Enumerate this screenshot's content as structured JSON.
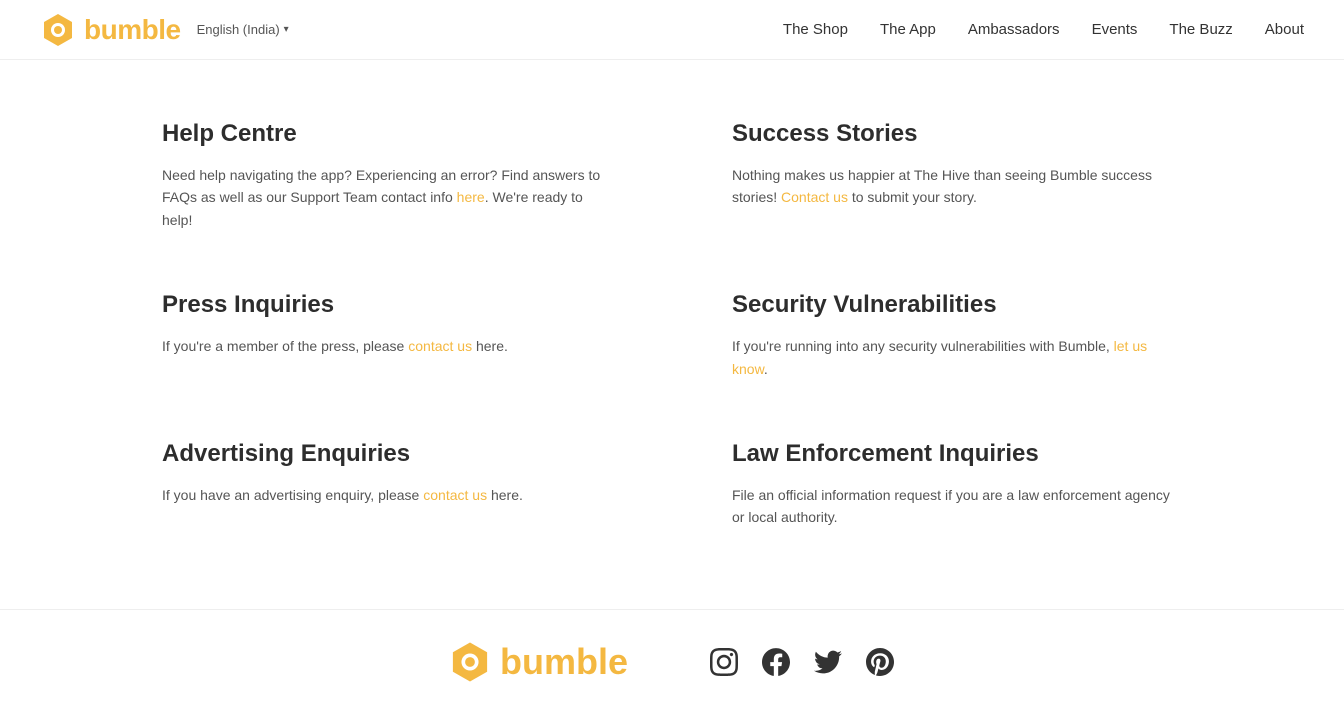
{
  "header": {
    "logo_text": "bumble",
    "lang": "English (India)",
    "nav": [
      {
        "label": "The Shop",
        "href": "#"
      },
      {
        "label": "The App",
        "href": "#"
      },
      {
        "label": "Ambassadors",
        "href": "#"
      },
      {
        "label": "Events",
        "href": "#"
      },
      {
        "label": "The Buzz",
        "href": "#"
      },
      {
        "label": "About",
        "href": "#"
      }
    ]
  },
  "cards": [
    {
      "id": "help-centre",
      "title": "Help Centre",
      "text_before": "Need help navigating the app? Experiencing an error? Find answers to FAQs as well as our Support Team contact info ",
      "link1_text": "here",
      "text_middle": ". We're ready to help!",
      "link2_text": null,
      "text_after": null
    },
    {
      "id": "success-stories",
      "title": "Success Stories",
      "text_before": "Nothing makes us happier at The Hive than seeing Bumble success stories! ",
      "link1_text": "Contact us",
      "text_middle": " to submit your story.",
      "link2_text": null,
      "text_after": null
    },
    {
      "id": "press-inquiries",
      "title": "Press Inquiries",
      "text_before": "If you're a member of the press, please ",
      "link1_text": "contact us",
      "text_middle": " here.",
      "link2_text": null,
      "text_after": null
    },
    {
      "id": "security-vulnerabilities",
      "title": "Security Vulnerabilities",
      "text_before": "If you're running into any security vulnerabilities with Bumble, ",
      "link1_text": "let us know",
      "text_middle": ".",
      "link2_text": null,
      "text_after": null
    },
    {
      "id": "advertising-enquiries",
      "title": "Advertising Enquiries",
      "text_before": "If you have an advertising enquiry, please ",
      "link1_text": "contact us",
      "text_middle": " here.",
      "link2_text": null,
      "text_after": null
    },
    {
      "id": "law-enforcement",
      "title": "Law Enforcement Inquiries",
      "text_before": "File an official information request if you are a law enforcement agency or local authority.",
      "link1_text": null,
      "text_middle": null,
      "link2_text": null,
      "text_after": null
    }
  ],
  "footer": {
    "logo_text": "bumble",
    "social": [
      "instagram",
      "facebook",
      "twitter",
      "pinterest"
    ]
  }
}
